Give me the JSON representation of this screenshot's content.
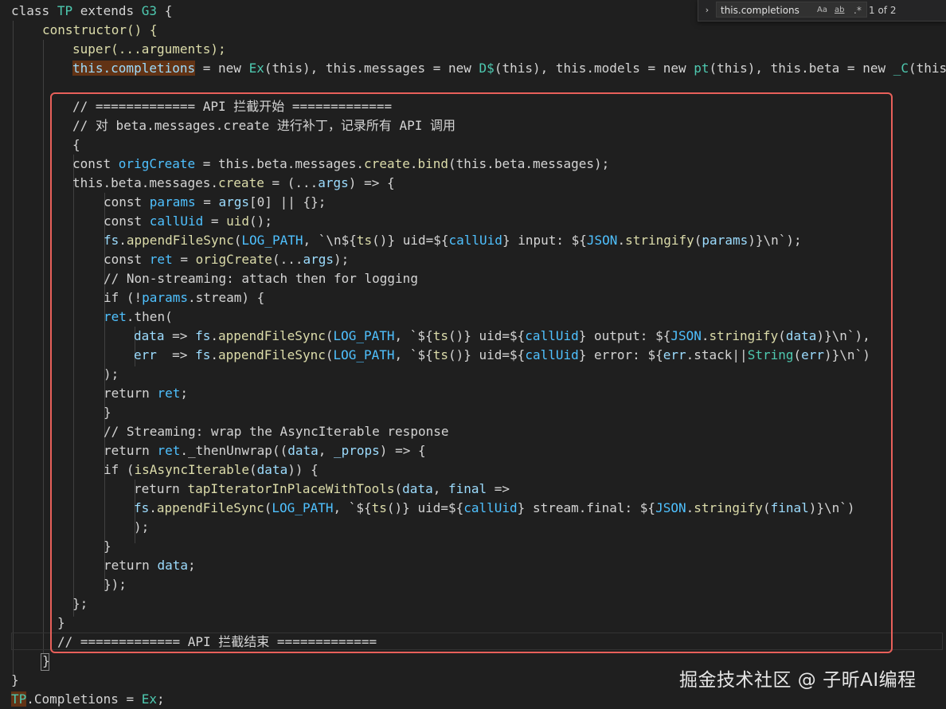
{
  "find_widget": {
    "query": "this.completions",
    "match_case": "Aa",
    "whole_word": "ab",
    "regex": ".*",
    "count": "1 of 2"
  },
  "code": {
    "l1": [
      "class",
      "TP",
      "extends",
      "G3",
      "{"
    ],
    "l2": [
      "constructor() {"
    ],
    "l3": [
      "super(...arguments);"
    ],
    "l4": [
      "this.completions",
      " = new ",
      "Ex",
      "(this), this.messages = new ",
      "D$",
      "(this), this.models = new ",
      "pt",
      "(this), this.beta = new ",
      "_C",
      "(this"
    ],
    "l5": [
      "// ============= API 拦截开始 ============="
    ],
    "l6": [
      "// 对 beta.messages.create 进行补丁，记录所有 API 调用"
    ],
    "l7": [
      "{"
    ],
    "l8": [
      "const ",
      "origCreate",
      " = this.beta.messages.",
      "create",
      ".",
      "bind",
      "(this.beta.messages);"
    ],
    "l9": [
      "this.beta.messages.",
      "create",
      " = (...",
      "args",
      ") => {"
    ],
    "l10": [
      "const ",
      "params",
      " = ",
      "args",
      "[0] || {};"
    ],
    "l11": [
      "const ",
      "callUid",
      " = ",
      "uid",
      "();"
    ],
    "l12": [
      "fs",
      ".",
      "appendFileSync",
      "(",
      "LOG_PATH",
      ", `\\n${",
      "ts",
      "()} uid=${",
      "callUid",
      "} input: ${",
      "JSON",
      ".",
      "stringify",
      "(",
      "params",
      ")}\\n`);"
    ],
    "l13": [
      "const ",
      "ret",
      " = ",
      "origCreate",
      "(...",
      "args",
      ");"
    ],
    "l14": [
      "// Non-streaming: attach then for logging"
    ],
    "l15": [
      "if (!",
      "params",
      ".stream) {"
    ],
    "l16": [
      "ret",
      ".then("
    ],
    "l17": [
      "data",
      " => ",
      "fs",
      ".",
      "appendFileSync",
      "(",
      "LOG_PATH",
      ", `${",
      "ts",
      "()} uid=${",
      "callUid",
      "} output: ${",
      "JSON",
      ".",
      "stringify",
      "(",
      "data",
      ")}\\n`),"
    ],
    "l18": [
      "err",
      "  => ",
      "fs",
      ".",
      "appendFileSync",
      "(",
      "LOG_PATH",
      ", `${",
      "ts",
      "()} uid=${",
      "callUid",
      "} error: ${",
      "err",
      ".stack||",
      "String",
      "(",
      "err",
      ")}\\n`)"
    ],
    "l19": [
      ");"
    ],
    "l20": [
      "return ",
      "ret",
      ";"
    ],
    "l21": [
      "}"
    ],
    "l22": [
      "// Streaming: wrap the AsyncIterable response"
    ],
    "l23": [
      "return ",
      "ret",
      "._thenUnwrap((",
      "data",
      ", ",
      "_props",
      ") => {"
    ],
    "l24": [
      "if (",
      "isAsyncIterable",
      "(",
      "data",
      ")) {"
    ],
    "l25": [
      "return ",
      "tapIteratorInPlaceWithTools",
      "(",
      "data",
      ", ",
      "final",
      " =>"
    ],
    "l26": [
      "fs",
      ".",
      "appendFileSync",
      "(",
      "LOG_PATH",
      ", `${",
      "ts",
      "()} uid=${",
      "callUid",
      "} stream.final: ${",
      "JSON",
      ".",
      "stringify",
      "(",
      "final",
      ")}\\n`)"
    ],
    "l27": [
      ");"
    ],
    "l28": [
      "}"
    ],
    "l29": [
      "return ",
      "data",
      ";"
    ],
    "l30": [
      "});"
    ],
    "l31": [
      "};"
    ],
    "l32": [
      "}"
    ],
    "l33": [
      "// ============= API 拦截结束 ============="
    ],
    "l34": [
      "}"
    ],
    "l35": [
      "}"
    ],
    "l36": [
      "TP",
      ".Completions = ",
      "Ex",
      ";"
    ]
  },
  "watermark": "掘金技术社区 @ 子昕AI编程",
  "colors": {
    "background": "#1f1f1f",
    "highlight_box": "#e8605a",
    "match_highlight": "#623315"
  }
}
